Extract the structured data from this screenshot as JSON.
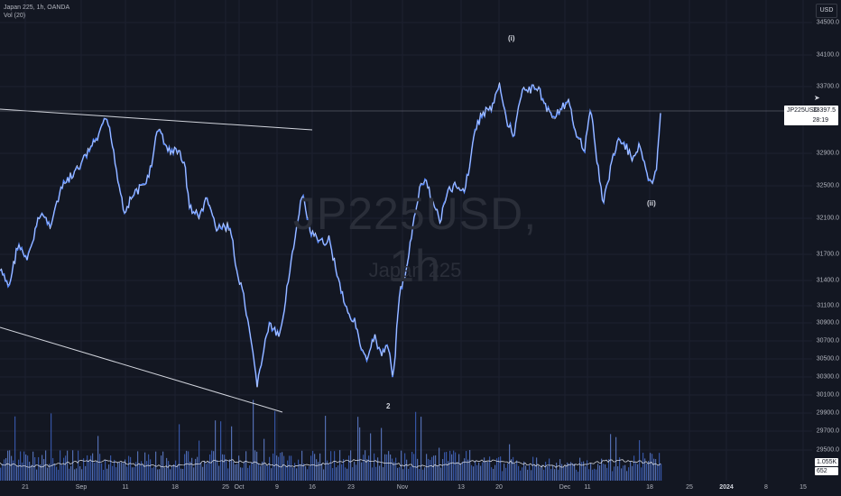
{
  "legend": {
    "title": "Japan 225, 1h, OANDA",
    "indicator": "Vol (20)"
  },
  "currency": "USD",
  "watermark": {
    "symbol": "JP225USD, 1h",
    "name": "Japan 225"
  },
  "price_ticks": [
    "34500.0",
    "34100.0",
    "33700.0",
    "32900.0",
    "32500.0",
    "32100.0",
    "31700.0",
    "31400.0",
    "31100.0",
    "30900.0",
    "30700.0",
    "30500.0",
    "30300.0",
    "30100.0",
    "29900.0",
    "29700.0",
    "29500.0"
  ],
  "time_ticks": [
    {
      "label": "21",
      "bold": false
    },
    {
      "label": "Sep",
      "bold": false
    },
    {
      "label": "11",
      "bold": false
    },
    {
      "label": "18",
      "bold": false
    },
    {
      "label": "25",
      "bold": false
    },
    {
      "label": "Oct",
      "bold": false
    },
    {
      "label": "9",
      "bold": false
    },
    {
      "label": "16",
      "bold": false
    },
    {
      "label": "23",
      "bold": false
    },
    {
      "label": "Nov",
      "bold": false
    },
    {
      "label": "13",
      "bold": false
    },
    {
      "label": "20",
      "bold": false
    },
    {
      "label": "Dec",
      "bold": false
    },
    {
      "label": "11",
      "bold": false
    },
    {
      "label": "18",
      "bold": false
    },
    {
      "label": "25",
      "bold": false
    },
    {
      "label": "2024",
      "bold": true
    },
    {
      "label": "8",
      "bold": false
    },
    {
      "label": "15",
      "bold": false
    }
  ],
  "wave_labels": {
    "w1": "(i)",
    "w2": "(ii)",
    "w3": "2"
  },
  "last_price": {
    "symbol": "JP225USD",
    "value": "33397.5",
    "countdown": "28:19"
  },
  "volume_labels": {
    "vol_value": "1.055K",
    "vol_ma": "652"
  },
  "colors": {
    "background": "#131722",
    "candles": "#5b8cff",
    "wick": "#ffffff",
    "volume": "#3c5fb8"
  }
}
